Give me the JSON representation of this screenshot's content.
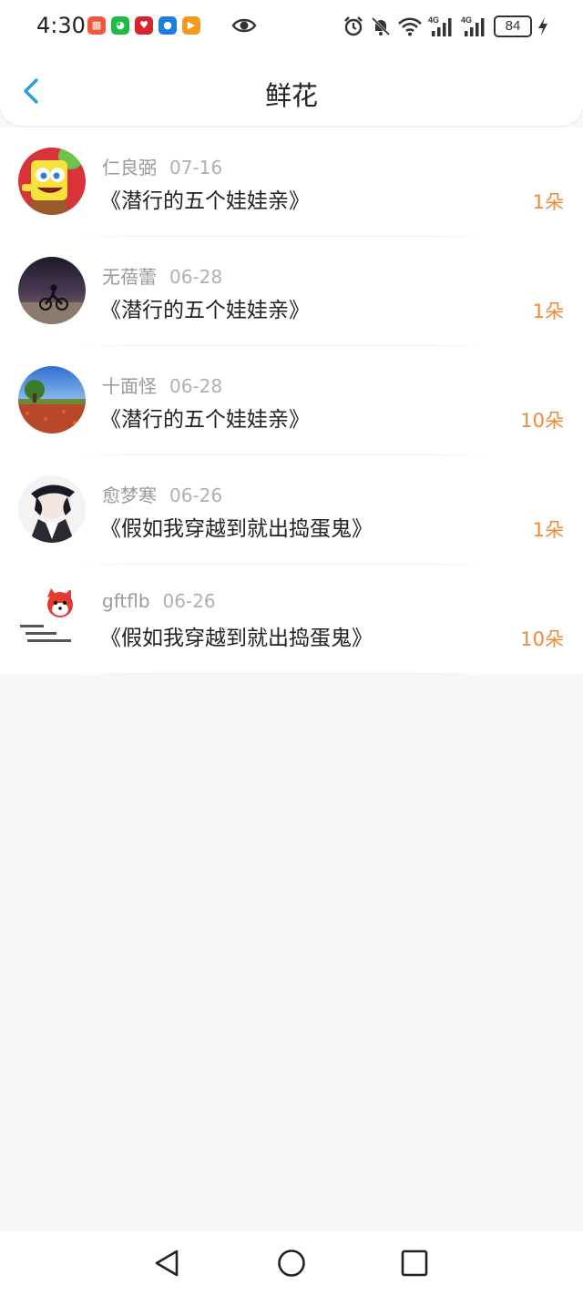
{
  "status_bar": {
    "time": "4:30",
    "app_icons": [
      {
        "name": "gallery-app-icon",
        "color": "#f05a3b"
      },
      {
        "name": "wechat-icon",
        "color": "#1fba48"
      },
      {
        "name": "heart-app-icon",
        "color": "#d9232e"
      },
      {
        "name": "weibo-app-icon",
        "color": "#1c7fe0"
      },
      {
        "name": "play-app-icon",
        "color": "#f29b1e"
      }
    ],
    "signal_1": "4G",
    "signal_2": "4G",
    "battery": "84"
  },
  "header": {
    "title": "鲜花",
    "accent_color": "#2e9be6"
  },
  "flowers": [
    {
      "user": "仁良弼",
      "date": "07-16",
      "book": "《潜行的五个娃娃亲》",
      "count": "1朵",
      "avatar": "spongebob"
    },
    {
      "user": "无蓓蕾",
      "date": "06-28",
      "book": "《潜行的五个娃娃亲》",
      "count": "1朵",
      "avatar": "motorbike"
    },
    {
      "user": "十面怪",
      "date": "06-28",
      "book": "《潜行的五个娃娃亲》",
      "count": "10朵",
      "avatar": "field-tree"
    },
    {
      "user": "愈梦寒",
      "date": "06-26",
      "book": "《假如我穿越到就出捣蛋鬼》",
      "count": "1朵",
      "avatar": "anime-boy"
    },
    {
      "user": "gftflb",
      "date": "06-26",
      "book": "《假如我穿越到就出捣蛋鬼》",
      "count": "10朵",
      "avatar": "red-fox"
    }
  ],
  "nav": {
    "back": "back-triangle-icon",
    "home": "home-circle-icon",
    "recents": "recents-square-icon"
  }
}
